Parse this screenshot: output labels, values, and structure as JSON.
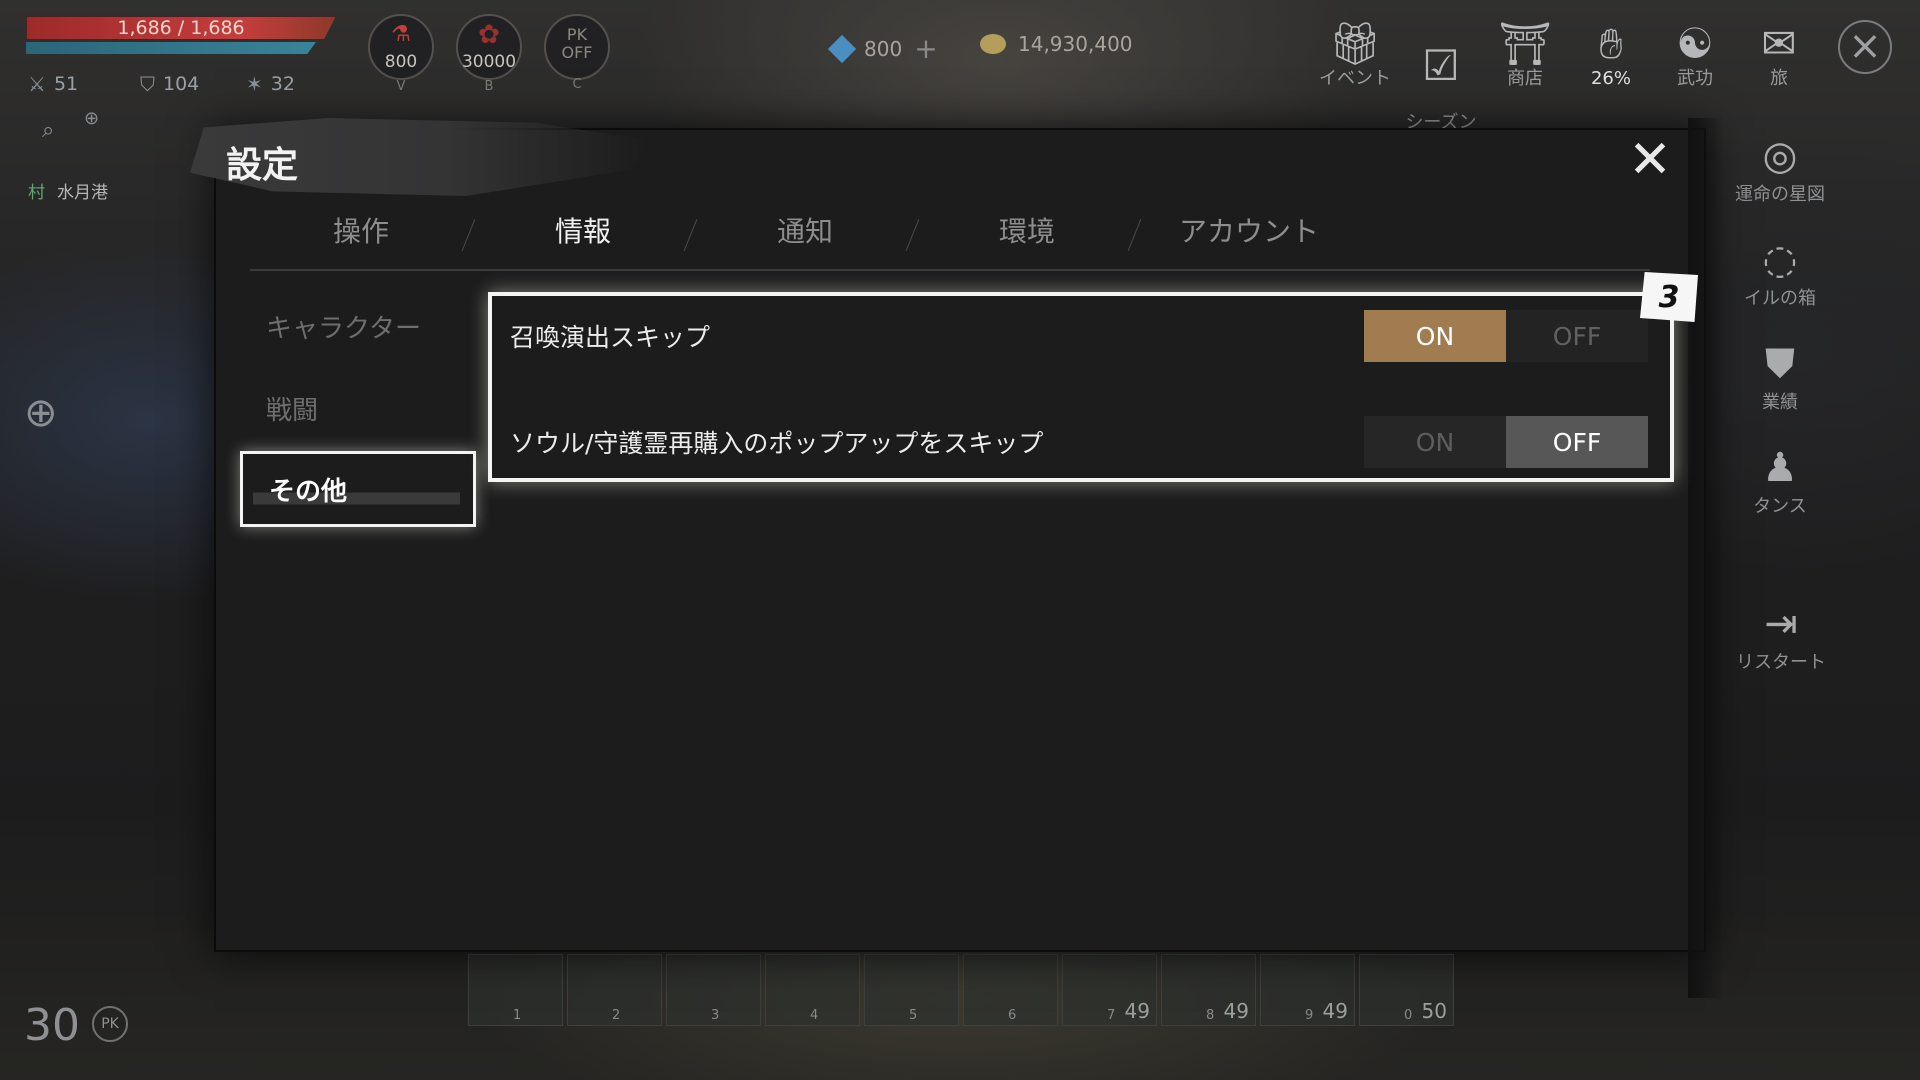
{
  "hud": {
    "hp_text": "1,686 / 1,686",
    "stats": [
      {
        "icon": "crossed-swords-icon",
        "value": "51"
      },
      {
        "icon": "shield-icon",
        "value": "104"
      },
      {
        "icon": "sparkle-icon",
        "value": "32"
      }
    ],
    "potion_count": "800",
    "potion_key": "V",
    "rose_count": "30000",
    "rose_key": "B",
    "pk_line1": "PK",
    "pk_line2": "OFF",
    "pk_key": "C",
    "location_tag": "村",
    "location_name": "水月港",
    "level": "30",
    "pk_small": "PK"
  },
  "currency": {
    "gems": "800",
    "gold": "14,930,400"
  },
  "top_menu": [
    {
      "icon": "gift-icon",
      "label": "イベント"
    },
    {
      "icon": "calendar-check-icon",
      "label": "シーズン\nパス"
    },
    {
      "icon": "shop-icon",
      "label": "商店"
    },
    {
      "icon": "hand-icon",
      "label": "26%"
    },
    {
      "icon": "yin-yang-icon",
      "label": "武功"
    },
    {
      "icon": "travel-icon",
      "label": "旅"
    }
  ],
  "side_menu": [
    {
      "icon": "spiral-icon",
      "label": "運命の星図"
    },
    {
      "icon": "swirl-icon",
      "label": "イルの箱"
    },
    {
      "icon": "emblem-icon",
      "label": "業績"
    },
    {
      "icon": "dancer-icon",
      "label": "タンス"
    },
    {
      "icon": "exit-arrow-icon",
      "label": "リスタート"
    }
  ],
  "hotbar": [
    {
      "n": "1",
      "c": ""
    },
    {
      "n": "2",
      "c": ""
    },
    {
      "n": "3",
      "c": ""
    },
    {
      "n": "4",
      "c": ""
    },
    {
      "n": "5",
      "c": ""
    },
    {
      "n": "6",
      "c": ""
    },
    {
      "n": "7",
      "c": "49"
    },
    {
      "n": "8",
      "c": "49"
    },
    {
      "n": "9",
      "c": "49"
    },
    {
      "n": "0",
      "c": "50"
    }
  ],
  "dialog": {
    "title": "設定",
    "tabs": [
      "操作",
      "情報",
      "通知",
      "環境",
      "アカウント"
    ],
    "active_tab": 1,
    "subnav": [
      "キャラクター",
      "戦闘",
      "その他"
    ],
    "active_sub": 2,
    "badge": "3",
    "settings": [
      {
        "label": "召喚演出スキップ",
        "on": "ON",
        "off": "OFF",
        "value": "ON"
      },
      {
        "label": "ソウル/守護霊再購入のポップアップをスキップ",
        "on": "ON",
        "off": "OFF",
        "value": "OFF"
      }
    ]
  },
  "colors": {
    "accent_on": "#a17c50",
    "off_active": "#575757"
  }
}
